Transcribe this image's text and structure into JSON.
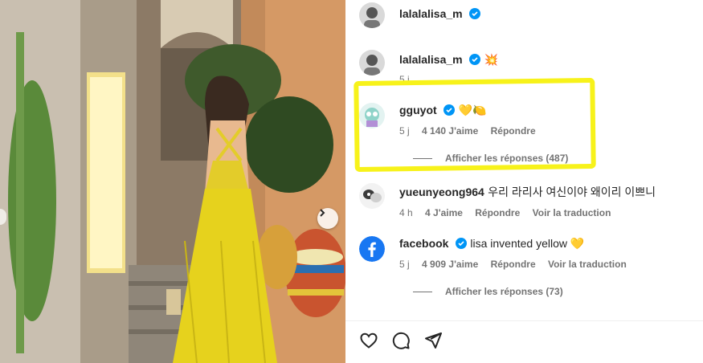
{
  "post": {
    "author": "lalalalisa_m"
  },
  "caption": {
    "author": "lalalalisa_m",
    "emoji": "💥",
    "time": "5 j"
  },
  "comments": [
    {
      "author": "gguyot",
      "text": "💛🍋",
      "time": "5 j",
      "likes": "4 140 J'aime",
      "reply": "Répondre",
      "translate": "",
      "view_replies": "Afficher les réponses (487)"
    },
    {
      "author": "yueunyeong964",
      "text": "우리 라리사 여신이야 왜이리 이쁘니",
      "time": "4 h",
      "likes": "4 J'aime",
      "reply": "Répondre",
      "translate": "Voir la traduction"
    },
    {
      "author": "facebook",
      "text": "lisa invented yellow 💛",
      "time": "5 j",
      "likes": "4 909 J'aime",
      "reply": "Répondre",
      "translate": "Voir la traduction",
      "view_replies": "Afficher les réponses (73)"
    }
  ],
  "icons": [
    "verified-icon",
    "heart-icon",
    "comment-icon",
    "share-icon",
    "chevron-right-icon"
  ],
  "colors": {
    "verified": "#0095f6",
    "highlight": "#f7f21a",
    "facebook": "#1877f2"
  }
}
